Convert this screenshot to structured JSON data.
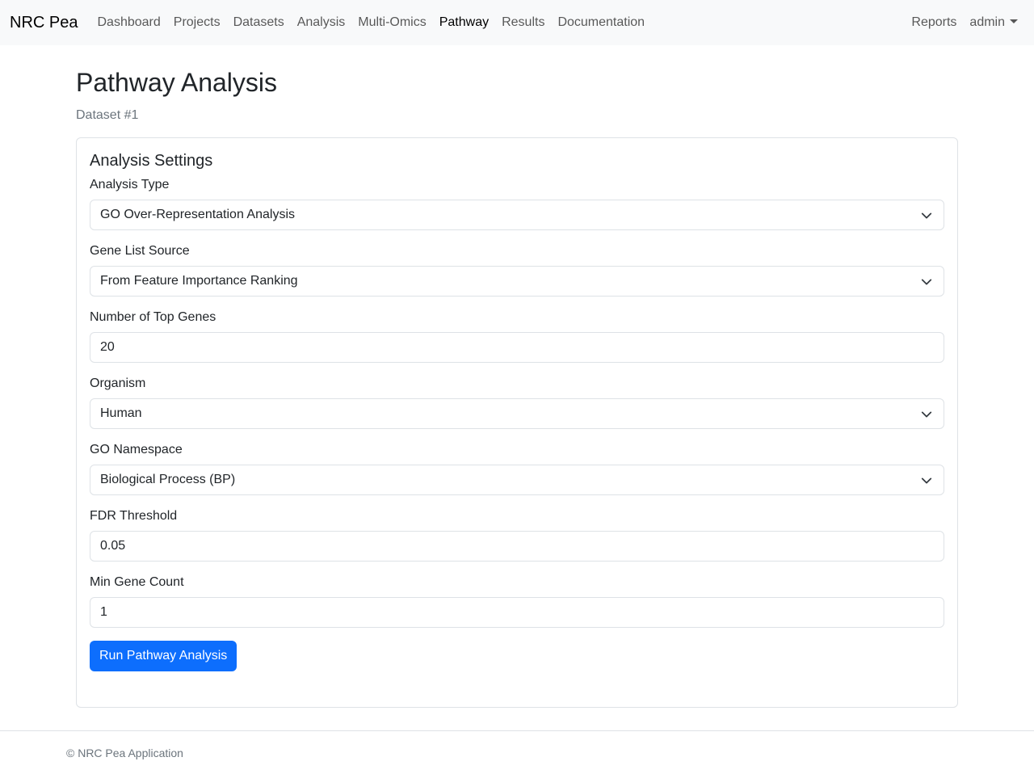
{
  "navbar": {
    "brand": "NRC Pea",
    "links": [
      {
        "label": "Dashboard",
        "active": false
      },
      {
        "label": "Projects",
        "active": false
      },
      {
        "label": "Datasets",
        "active": false
      },
      {
        "label": "Analysis",
        "active": false
      },
      {
        "label": "Multi-Omics",
        "active": false
      },
      {
        "label": "Pathway",
        "active": true
      },
      {
        "label": "Results",
        "active": false
      },
      {
        "label": "Documentation",
        "active": false
      }
    ],
    "reports_label": "Reports",
    "user_label": "admin"
  },
  "page": {
    "title": "Pathway Analysis",
    "subtitle": "Dataset #1"
  },
  "settings": {
    "title": "Analysis Settings",
    "analysis_type": {
      "label": "Analysis Type",
      "value": "GO Over-Representation Analysis"
    },
    "gene_list_source": {
      "label": "Gene List Source",
      "value": "From Feature Importance Ranking"
    },
    "top_genes": {
      "label": "Number of Top Genes",
      "value": "20"
    },
    "organism": {
      "label": "Organism",
      "value": "Human"
    },
    "go_namespace": {
      "label": "GO Namespace",
      "value": "Biological Process (BP)"
    },
    "fdr_threshold": {
      "label": "FDR Threshold",
      "value": "0.05"
    },
    "min_gene_count": {
      "label": "Min Gene Count",
      "value": "1"
    },
    "run_button": "Run Pathway Analysis"
  },
  "footer": {
    "text": "© NRC Pea Application"
  },
  "colors": {
    "primary": "#0d6efd",
    "navbar_bg": "#f8f9fa"
  }
}
